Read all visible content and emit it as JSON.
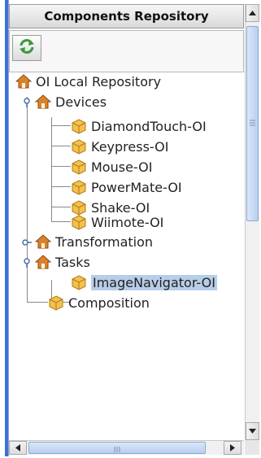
{
  "panel": {
    "title": "Components Repository"
  },
  "toolbar": {
    "refresh_icon": "refresh-icon"
  },
  "tree": {
    "root": "OI Local Repository",
    "devices": {
      "label": "Devices",
      "children": [
        "DiamondTouch-OI",
        "Keypress-OI",
        "Mouse-OI",
        "PowerMate-OI",
        "Shake-OI",
        "Wiimote-OI"
      ]
    },
    "transformation": {
      "label": "Transformation"
    },
    "tasks": {
      "label": "Tasks",
      "children": [
        "ImageNavigator-OI"
      ]
    },
    "composition": {
      "label": "Composition"
    },
    "selected": "ImageNavigator-OI"
  },
  "colors": {
    "selection": "#b7cde8",
    "accent_border": "#3f6fd8",
    "refresh_green": "#3a9a3a",
    "house_orange": "#d9822b",
    "box_yellow": "#f2c14e"
  }
}
